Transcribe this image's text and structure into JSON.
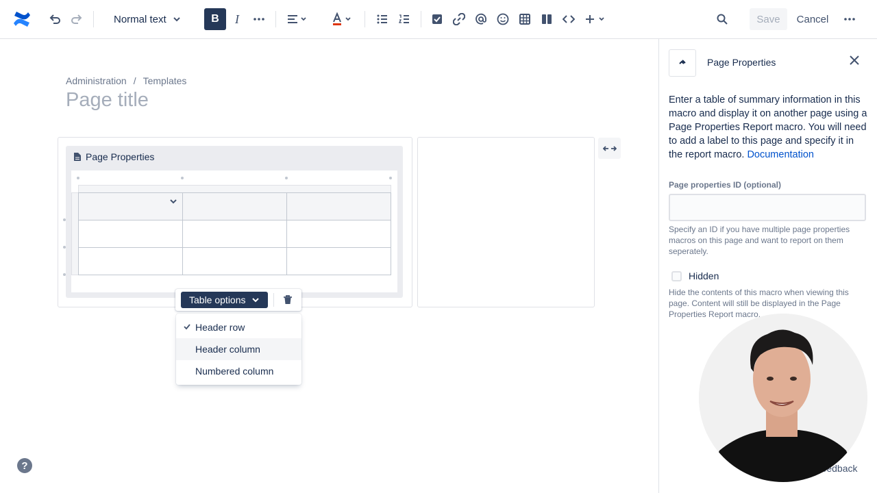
{
  "toolbar": {
    "text_style": "Normal text",
    "bold_label": "B",
    "save_label": "Save",
    "cancel_label": "Cancel"
  },
  "editor": {
    "breadcrumb": [
      "Administration",
      "/",
      "Templates"
    ],
    "page_title_placeholder": "Page title",
    "macro_title": "Page Properties"
  },
  "table_toolbar": {
    "options_label": "Table options",
    "dropdown_items": [
      {
        "label": "Header row",
        "checked": true
      },
      {
        "label": "Header column",
        "checked": false
      },
      {
        "label": "Numbered column",
        "checked": false
      }
    ]
  },
  "panel": {
    "title": "Page Properties",
    "description": "Enter a table of summary information in this macro and display it on another page using a Page Properties Report macro. You will need to add a label to this page and specify it in the report macro.",
    "doc_link": "Documentation",
    "id_label": "Page properties ID (optional)",
    "id_value": "",
    "id_help": "Specify an ID if you have multiple page properties macros on this page and want to report on them seperately.",
    "hidden_label": "Hidden",
    "hidden_checked": false,
    "hidden_help": "Hide the contents of this macro when viewing this page. Content will still be displayed in the Page Properties Report macro.",
    "feedback_label": "Feedback"
  },
  "help_label": "?",
  "colors": {
    "brand": "#0052cc",
    "dark_button": "#253858",
    "text": "#172b4d"
  }
}
